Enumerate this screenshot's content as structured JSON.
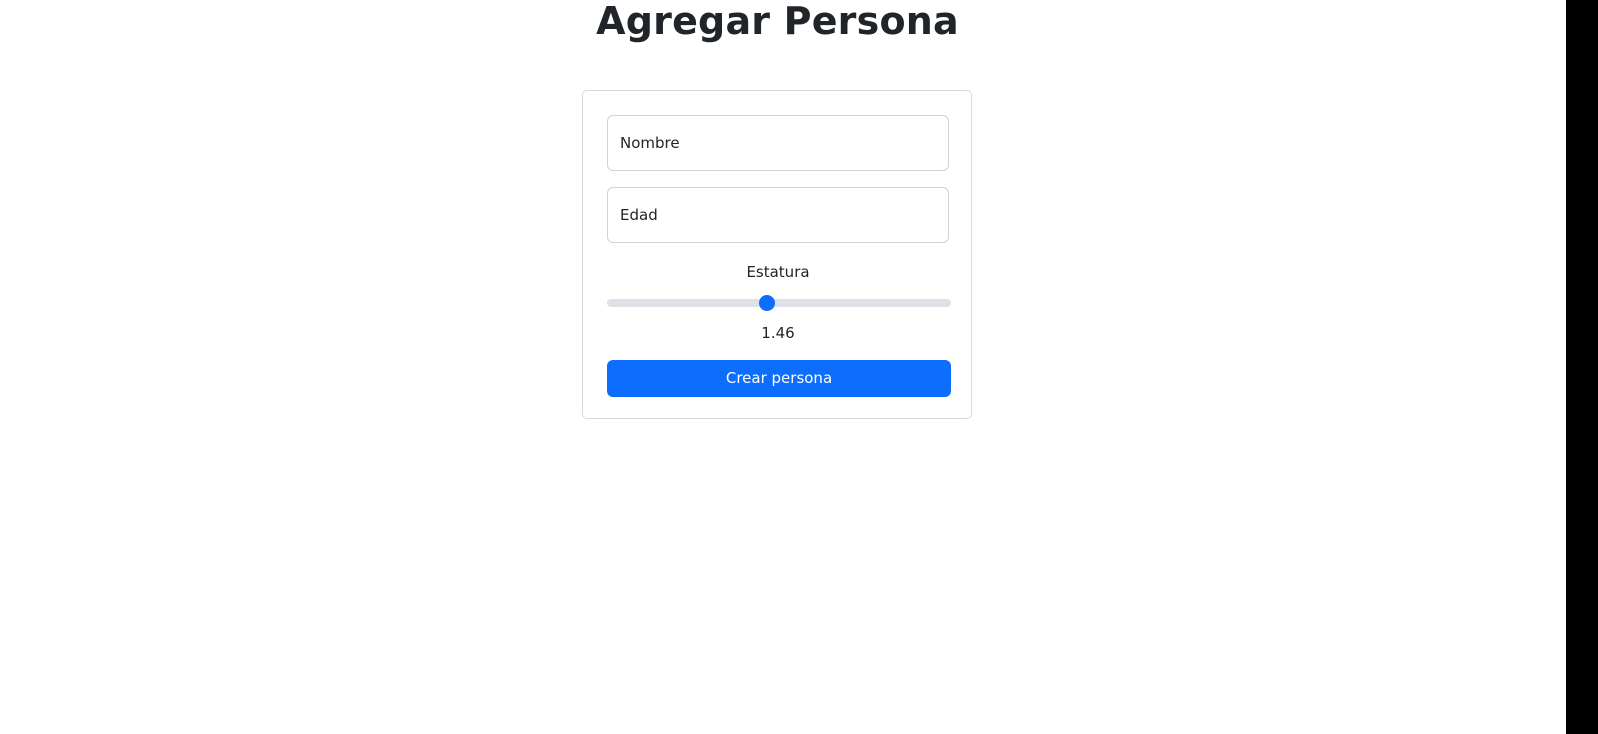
{
  "page": {
    "title": "Agregar Persona"
  },
  "form": {
    "nombre_placeholder": "Nombre",
    "edad_placeholder": "Edad",
    "estatura_label": "Estatura",
    "estatura_value": "1.46",
    "estatura_fraction": 0.464,
    "submit_label": "Crear persona"
  },
  "colors": {
    "accent": "#0d6efd",
    "text": "#212529",
    "border": "#ced4da",
    "track": "#dee2e6"
  }
}
